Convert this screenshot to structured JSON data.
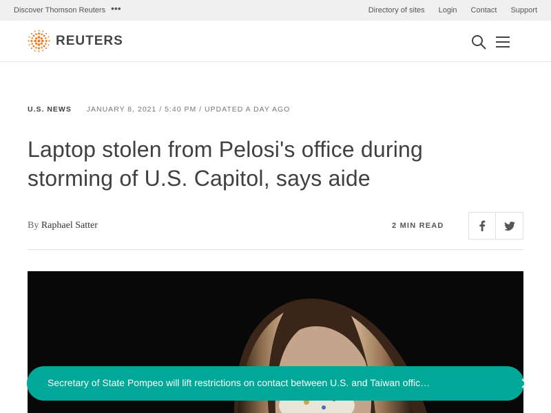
{
  "utility_bar": {
    "discover": "Discover Thomson Reuters",
    "more": "•••",
    "links": [
      "Directory of sites",
      "Login",
      "Contact",
      "Support"
    ]
  },
  "header": {
    "logo_text": "REUTERS",
    "brand_color": "#f47b20",
    "search_icon": "search-icon",
    "menu_icon": "hamburger-menu-icon"
  },
  "article": {
    "section": "U.S. News",
    "dateline": "January 8, 2021 / 5:40 PM / Updated a day ago",
    "headline": "Laptop stolen from Pelosi's office during storming of U.S. Capitol, says aide",
    "byline_prefix": "By",
    "author": "Raphael Satter",
    "read_time": "2 Min Read",
    "share": [
      "facebook-icon",
      "twitter-icon"
    ]
  },
  "breaking_banner": {
    "text": "Secretary of State Pompeo will lift restrictions on contact between U.S. and Taiwan offic…",
    "color": "#00a89a",
    "close_icon": "close-icon"
  }
}
